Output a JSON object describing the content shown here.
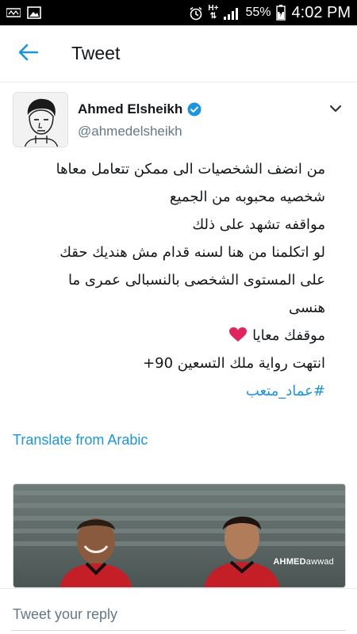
{
  "status_bar": {
    "battery": "55%",
    "time": "4:02 PM",
    "network": "H+"
  },
  "app_bar": {
    "title": "Tweet"
  },
  "tweet": {
    "author": {
      "display_name": "Ahmed Elsheikh",
      "handle": "@ahmedelsheikh",
      "verified": true
    },
    "lines": [
      "من انضف الشخصيات الى ممكن تتعامل معاها",
      "شخصيه محبوبه من الجميع",
      "مواقفه تشهد على ذلك",
      "لو اتكلمنا من هنا لسنه قدام مش هنديك حقك",
      "على المستوى الشخصى بالنسبالى عمرى ما",
      "هنسى",
      "موقفك معايا",
      "انتهت رواية ملك التسعين 90+"
    ],
    "hashtag": "#عماد_متعب",
    "translate_label": "Translate from Arabic",
    "media": {
      "watermark_bold": "AHMED",
      "watermark_thin": "awwad"
    }
  },
  "reply": {
    "placeholder": "Tweet your reply"
  },
  "colors": {
    "accent": "#1b95e0",
    "text": "#14171a",
    "secondary_text": "#657786",
    "heart": "#e0245e"
  }
}
